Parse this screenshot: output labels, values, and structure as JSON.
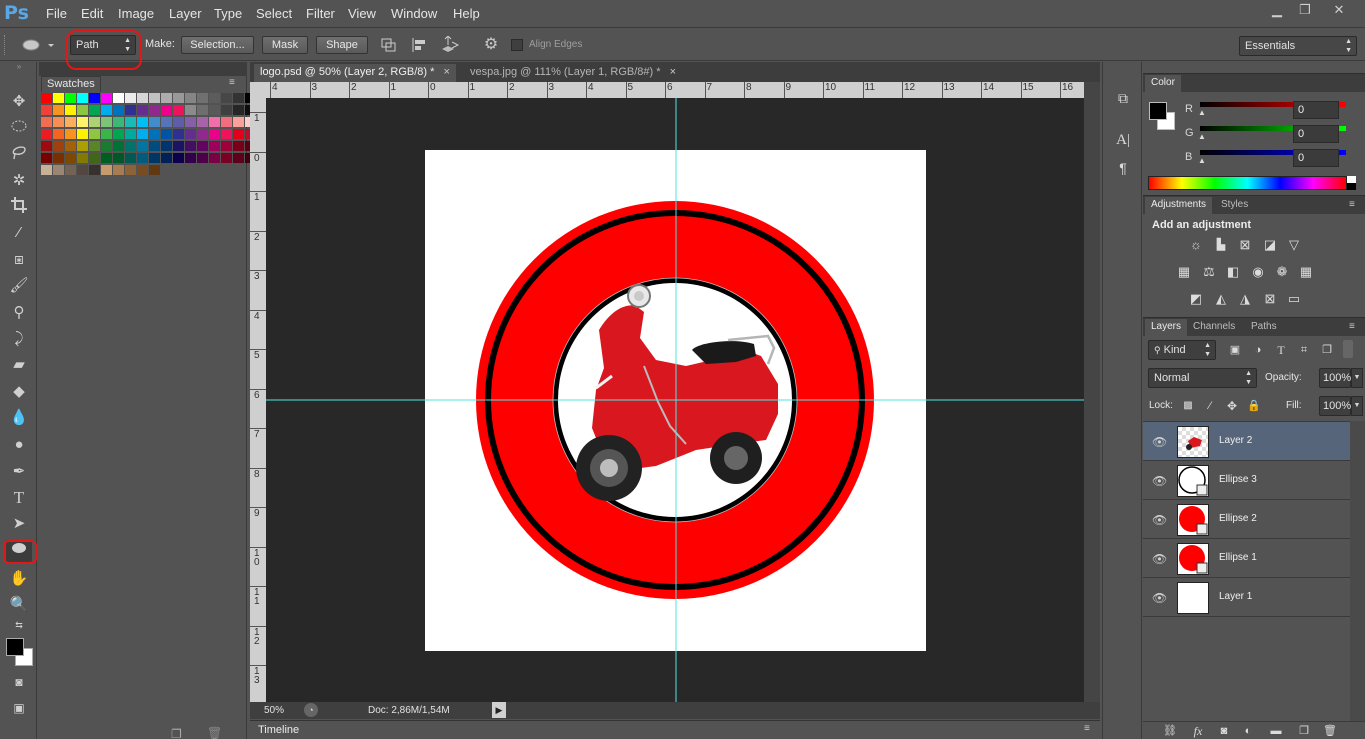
{
  "app": {
    "logo": "Ps"
  },
  "menu": [
    "File",
    "Edit",
    "Image",
    "Layer",
    "Type",
    "Select",
    "Filter",
    "View",
    "Window",
    "Help"
  ],
  "window_controls": [
    "minimize-icon",
    "restore-icon",
    "close-icon"
  ],
  "options": {
    "mode": "Path",
    "make_label": "Make:",
    "selection_btn": "Selection...",
    "mask_btn": "Mask",
    "shape_btn": "Shape",
    "align_edges": "Align Edges",
    "workspace": "Essentials"
  },
  "swatches": {
    "tab": "Swatches"
  },
  "documents": [
    {
      "title": "logo.psd @ 50% (Layer 2, RGB/8) *",
      "active": true
    },
    {
      "title": "vespa.jpg @ 111% (Layer 1, RGB/8#) *",
      "active": false
    }
  ],
  "ruler": {
    "top": [
      "4",
      "3",
      "2",
      "1",
      "0",
      "1",
      "2",
      "3",
      "4",
      "5",
      "6",
      "7",
      "8",
      "9",
      "10",
      "11",
      "12",
      "13",
      "14",
      "15",
      "16"
    ],
    "left": [
      "1",
      "0",
      "1",
      "2",
      "3",
      "4",
      "5",
      "6",
      "7",
      "8",
      "9",
      "1 0",
      "1 1",
      "1 2",
      "1 3"
    ]
  },
  "status": {
    "zoom": "50%",
    "doc": "Doc: 2,86M/1,54M"
  },
  "timeline": "Timeline",
  "color_panel": {
    "tab": "Color",
    "channels": [
      {
        "label": "R",
        "value": "0"
      },
      {
        "label": "G",
        "value": "0"
      },
      {
        "label": "B",
        "value": "0"
      }
    ]
  },
  "adjustments_panel": {
    "tabs": [
      "Adjustments",
      "Styles"
    ],
    "heading": "Add an adjustment"
  },
  "layers_panel": {
    "tabs": [
      "Layers",
      "Channels",
      "Paths"
    ],
    "filter_kind": "Kind",
    "blend_mode": "Normal",
    "opacity_label": "Opacity:",
    "opacity": "100%",
    "lock_label": "Lock:",
    "fill_label": "Fill:",
    "fill": "100%",
    "layers": [
      {
        "name": "Layer 2",
        "selected": true
      },
      {
        "name": "Ellipse 3",
        "selected": false
      },
      {
        "name": "Ellipse 2",
        "selected": false
      },
      {
        "name": "Ellipse 1",
        "selected": false
      },
      {
        "name": "Layer 1",
        "selected": false
      }
    ]
  },
  "colors": {
    "ui_bg": "#535353",
    "canvas_bg": "#282828",
    "red": "#ff0000",
    "guide": "#4fe3e3",
    "selected_layer": "#56657a",
    "annotation": "#e01818"
  }
}
